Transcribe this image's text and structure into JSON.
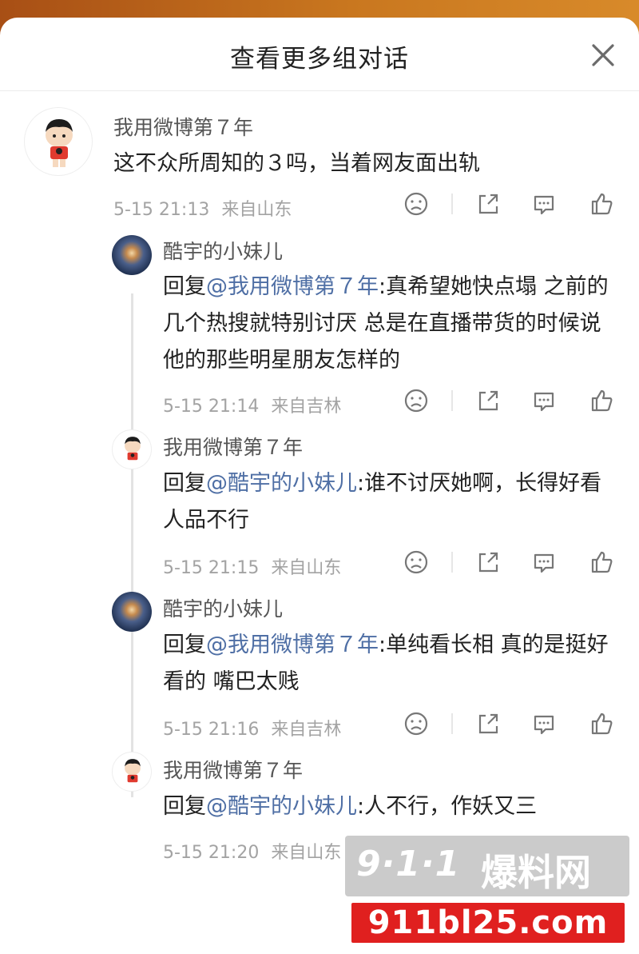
{
  "header": {
    "title": "查看更多组对话"
  },
  "comments": [
    {
      "name": "我用微博第７年",
      "text": "这不众所周知的３吗，当着网友面出轨",
      "time": "5-15 21:13",
      "location": "来自山东",
      "avatar": "cartoon-boy"
    },
    {
      "name": "酷宇的小妹儿",
      "reply_prefix": "回复",
      "mention": "@我用微博第７年",
      "text": ":真希望她快点塌 之前的几个热搜就特别讨厌 总是在直播带货的时候说他的那些明星朋友怎样的",
      "time": "5-15 21:14",
      "location": "来自吉林",
      "avatar": "night-city"
    },
    {
      "name": "我用微博第７年",
      "reply_prefix": "回复",
      "mention": "@酷宇的小妹儿",
      "text": ":谁不讨厌她啊，长得好看人品不行",
      "time": "5-15 21:15",
      "location": "来自山东",
      "avatar": "cartoon-boy"
    },
    {
      "name": "酷宇的小妹儿",
      "reply_prefix": "回复",
      "mention": "@我用微博第７年",
      "text": ":单纯看长相 真的是挺好看的 嘴巴太贱",
      "time": "5-15 21:16",
      "location": "来自吉林",
      "avatar": "night-city"
    },
    {
      "name": "我用微博第７年",
      "reply_prefix": "回复",
      "mention": "@酷宇的小妹儿",
      "text": ":人不行，作妖又三",
      "time": "5-15 21:20",
      "location": "来自山东",
      "avatar": "cartoon-boy"
    }
  ],
  "icons": {
    "close": "close-icon",
    "dislike": "sad-face-icon",
    "share": "share-icon",
    "comment": "comment-icon",
    "like": "thumbs-up-icon"
  },
  "watermark": {
    "logo": "9·1·1",
    "brand": "爆料网",
    "url": "911bl25.com"
  },
  "colors": {
    "mention": "#4f6fa5",
    "meta": "#a3a3a3",
    "watermark_red": "#e0201f"
  }
}
